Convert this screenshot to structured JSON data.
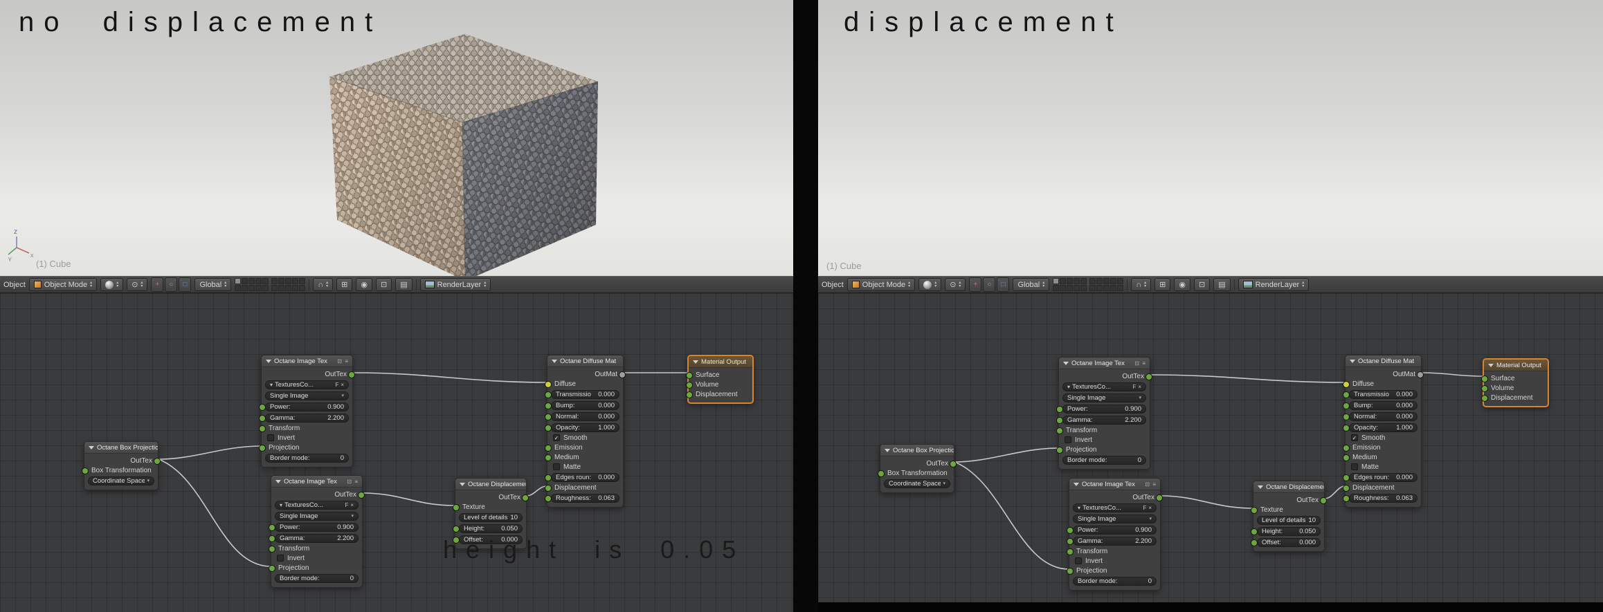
{
  "left": {
    "caption": "no displacement",
    "viewport_label": "(1) Cube",
    "note": "height is 0.05"
  },
  "right": {
    "caption": "displacement",
    "viewport_label": "(1) Cube"
  },
  "header": {
    "menu": "Object",
    "mode": "Object Mode",
    "orientation": "Global",
    "render_layer": "RenderLayer"
  },
  "nodes": {
    "image_tex": {
      "title": "Octane Image Tex",
      "output": "OutTex",
      "datablock": "TexturesCo...",
      "fake_user": "F",
      "source": "Single Image",
      "power_label": "Power:",
      "power": "0.900",
      "gamma_label": "Gamma:",
      "gamma": "2.200",
      "transform": "Transform",
      "invert": "Invert",
      "projection": "Projection",
      "border_label": "Border mode:",
      "border": "0"
    },
    "diffuse_mat": {
      "title": "Octane Diffuse Mat",
      "output": "OutMat",
      "diffuse": "Diffuse",
      "transmission_label": "Transmissio",
      "transmission": "0.000",
      "bump_label": "Bump:",
      "bump": "0.000",
      "normal_label": "Normal:",
      "normal": "0.000",
      "opacity_label": "Opacity:",
      "opacity": "1.000",
      "smooth": "Smooth",
      "emission": "Emission",
      "medium": "Medium",
      "matte": "Matte",
      "edges_label": "Edges roun:",
      "edges": "0.000",
      "displacement": "Displacement",
      "roughness_label": "Roughness:",
      "roughness": "0.063"
    },
    "material_output": {
      "title": "Material Output",
      "surface": "Surface",
      "volume": "Volume",
      "displacement": "Displacement"
    },
    "box_projection": {
      "title": "Octane Box Projection",
      "output": "OutTex",
      "transform": "Box Transformation",
      "coordinate": "Coordinate Space0"
    },
    "displacement_node": {
      "title": "Octane Displacement",
      "output": "OutTex",
      "texture": "Texture",
      "detail_label": "Level of details:",
      "detail": "10",
      "height_label": "Height:",
      "height": "0.050",
      "offset_label": "Offset:",
      "offset": "0.000"
    }
  },
  "colors": {
    "selection_outline": "#d8862e",
    "socket_green": "#6da83f",
    "socket_yellow": "#cfcf3a",
    "editor_background": "#3a3b3d"
  }
}
